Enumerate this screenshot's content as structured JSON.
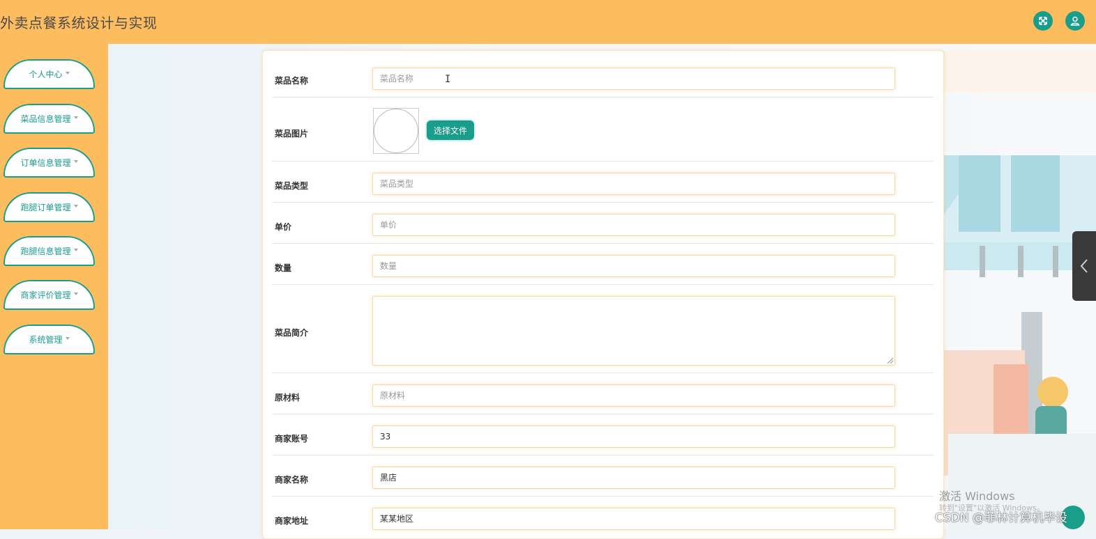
{
  "header": {
    "title": "外卖点餐系统设计与实现",
    "accent_color": "#1a9e8c",
    "bar_color": "#fdbd5f",
    "icons": [
      "fullscreen-icon",
      "user-icon"
    ]
  },
  "sidebar": {
    "items": [
      {
        "label": "个人中心"
      },
      {
        "label": "菜品信息管理"
      },
      {
        "label": "订单信息管理"
      },
      {
        "label": "跑腿订单管理"
      },
      {
        "label": "跑腿信息管理"
      },
      {
        "label": "商家评价管理"
      },
      {
        "label": "系统管理"
      }
    ]
  },
  "form": {
    "dish_name": {
      "label": "菜品名称",
      "placeholder": "菜品名称",
      "value": ""
    },
    "dish_image": {
      "label": "菜品图片",
      "button": "选择文件"
    },
    "dish_type": {
      "label": "菜品类型",
      "placeholder": "菜品类型",
      "value": ""
    },
    "price": {
      "label": "单价",
      "placeholder": "单价",
      "value": ""
    },
    "quantity": {
      "label": "数量",
      "placeholder": "数量",
      "value": ""
    },
    "intro": {
      "label": "菜品简介",
      "value": ""
    },
    "material": {
      "label": "原材料",
      "placeholder": "原材料",
      "value": ""
    },
    "merchant_account": {
      "label": "商家账号",
      "value": "33"
    },
    "merchant_name": {
      "label": "商家名称",
      "value": "黑店"
    },
    "merchant_address": {
      "label": "商家地址",
      "value": "某某地区"
    }
  },
  "overlay": {
    "windows_activate": "激活 Windows",
    "windows_sub": "转到\"设置\"以激活 Windows。",
    "csdn": "CSDN @菲林计算机毕设"
  }
}
